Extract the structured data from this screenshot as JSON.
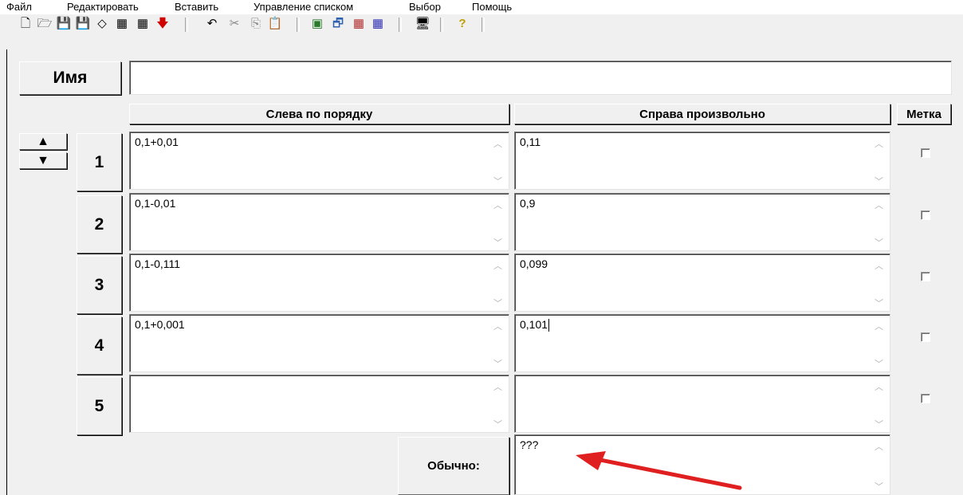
{
  "menu": [
    "Файл",
    "Редактировать",
    "Вставить",
    "Управление списком",
    "Выбор",
    "Помощь"
  ],
  "toolbar": {
    "icons": [
      "new-doc-icon",
      "open-folder-icon",
      "save-icon",
      "save-as-icon",
      "eraser-icon",
      "import-icon",
      "export-icon",
      "red-down-arrow-icon",
      "undo-icon",
      "cut-icon",
      "copy-icon",
      "paste-icon",
      "tool-1-icon",
      "tool-2-icon",
      "tool-3-icon",
      "tool-4-icon",
      "monitor-icon",
      "help-icon"
    ],
    "glyphs": [
      "🗋",
      "🗁",
      "💾",
      "💾",
      "◇",
      "▦",
      "▦",
      "🡇",
      "↶",
      "✂",
      "⎘",
      "📋",
      "▣",
      "🗗",
      "▦",
      "▦",
      "🖥",
      "?"
    ]
  },
  "form": {
    "name_label": "Имя",
    "name_value": "",
    "col_left": "Слева по порядку",
    "col_right": "Справа произвольно",
    "col_mark": "Метка",
    "rows": [
      {
        "num": "1",
        "left": "0,1+0,01",
        "right": "0,11",
        "checked": false
      },
      {
        "num": "2",
        "left": "0,1-0,01",
        "right": "0,9",
        "checked": false
      },
      {
        "num": "3",
        "left": "0,1-0,111",
        "right": "0,099",
        "checked": false
      },
      {
        "num": "4",
        "left": "0,1+0,001",
        "right": "0,101",
        "checked": false
      },
      {
        "num": "5",
        "left": "",
        "right": "",
        "checked": false
      }
    ],
    "usual_label": "Обычно:",
    "usual_value": "???"
  },
  "colors": {
    "annotation_arrow": "#e02020"
  }
}
